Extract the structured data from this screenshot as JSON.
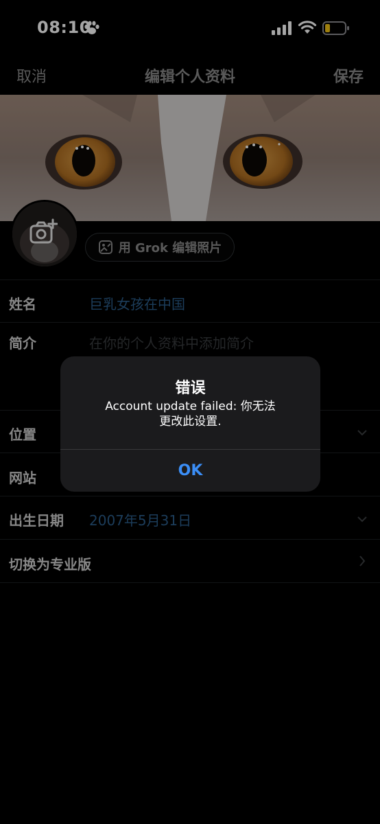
{
  "status_bar": {
    "time": "08:10"
  },
  "nav": {
    "cancel": "取消",
    "title": "编辑个人资料",
    "save": "保存"
  },
  "grok_button": {
    "label": "用 Grok 编辑照片"
  },
  "fields": {
    "name": {
      "label": "姓名",
      "value": "巨乳女孩在中国"
    },
    "bio": {
      "label": "简介",
      "placeholder": "在你的个人资料中添加简介"
    },
    "location": {
      "label": "位置"
    },
    "website": {
      "label": "网站"
    },
    "birthday": {
      "label": "出生日期",
      "value": "2007年5月31日"
    },
    "professional": {
      "label": "切换为专业版"
    }
  },
  "alert": {
    "title": "错误",
    "message_line1": "Account update failed: 你无法",
    "message_line2": "更改此设置.",
    "ok": "OK"
  },
  "colors": {
    "accent_blue": "#3b8ef6",
    "link_blue": "#2c5e8c",
    "background": "#000000"
  }
}
